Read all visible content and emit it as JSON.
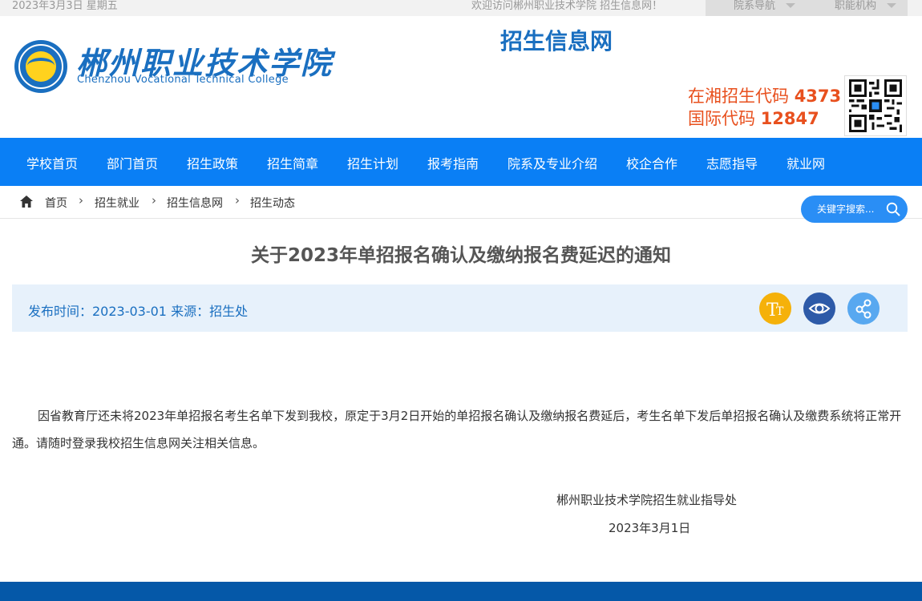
{
  "topbar": {
    "date": "2023年3月3日 星期五",
    "welcome": "欢迎访问郴州职业技术学院 招生信息网！",
    "dropdowns": [
      "院系导航",
      "职能机构"
    ]
  },
  "header": {
    "logo_cn": "郴州职业技术学院",
    "logo_en": "Chenzhou Vocational Technical College",
    "site_title": "招生信息网",
    "code1_label": "在湘招生代码",
    "code1_value": "4373",
    "code2_label": "国际代码",
    "code2_value": "12847"
  },
  "nav": {
    "items": [
      "学校首页",
      "部门首页",
      "招生政策",
      "招生简章",
      "招生计划",
      "报考指南",
      "院系及专业介绍",
      "校企合作",
      "志愿指导",
      "就业网"
    ]
  },
  "breadcrumb": {
    "items": [
      "首页",
      "招生就业",
      "招生信息网",
      "招生动态"
    ]
  },
  "search": {
    "placeholder": "关键字搜索..."
  },
  "article": {
    "title": "关于2023年单招报名确认及缴纳报名费延迟的通知",
    "meta": "发布时间：2023-03-01 来源：招生处",
    "body": "因省教育厅还未将2023年单招报名考生名单下发到我校，原定于3月2日开始的单招报名确认及缴纳报名费延后，考生名单下发后单招报名确认及缴费系统将正常开通。请随时登录我校招生信息网关注相关信息。",
    "signature": "郴州职业技术学院招生就业指导处",
    "sign_date": "2023年3月1日"
  },
  "colors": {
    "nav_bg": "#0a7ff5",
    "brand_blue": "#1a6fc0",
    "code_orange": "#e8501e",
    "meta_bg": "#e7f1fb",
    "footer_bg": "#0558a8"
  },
  "icons": {
    "tools": [
      "font-size-icon",
      "eye-icon",
      "share-icon"
    ]
  }
}
